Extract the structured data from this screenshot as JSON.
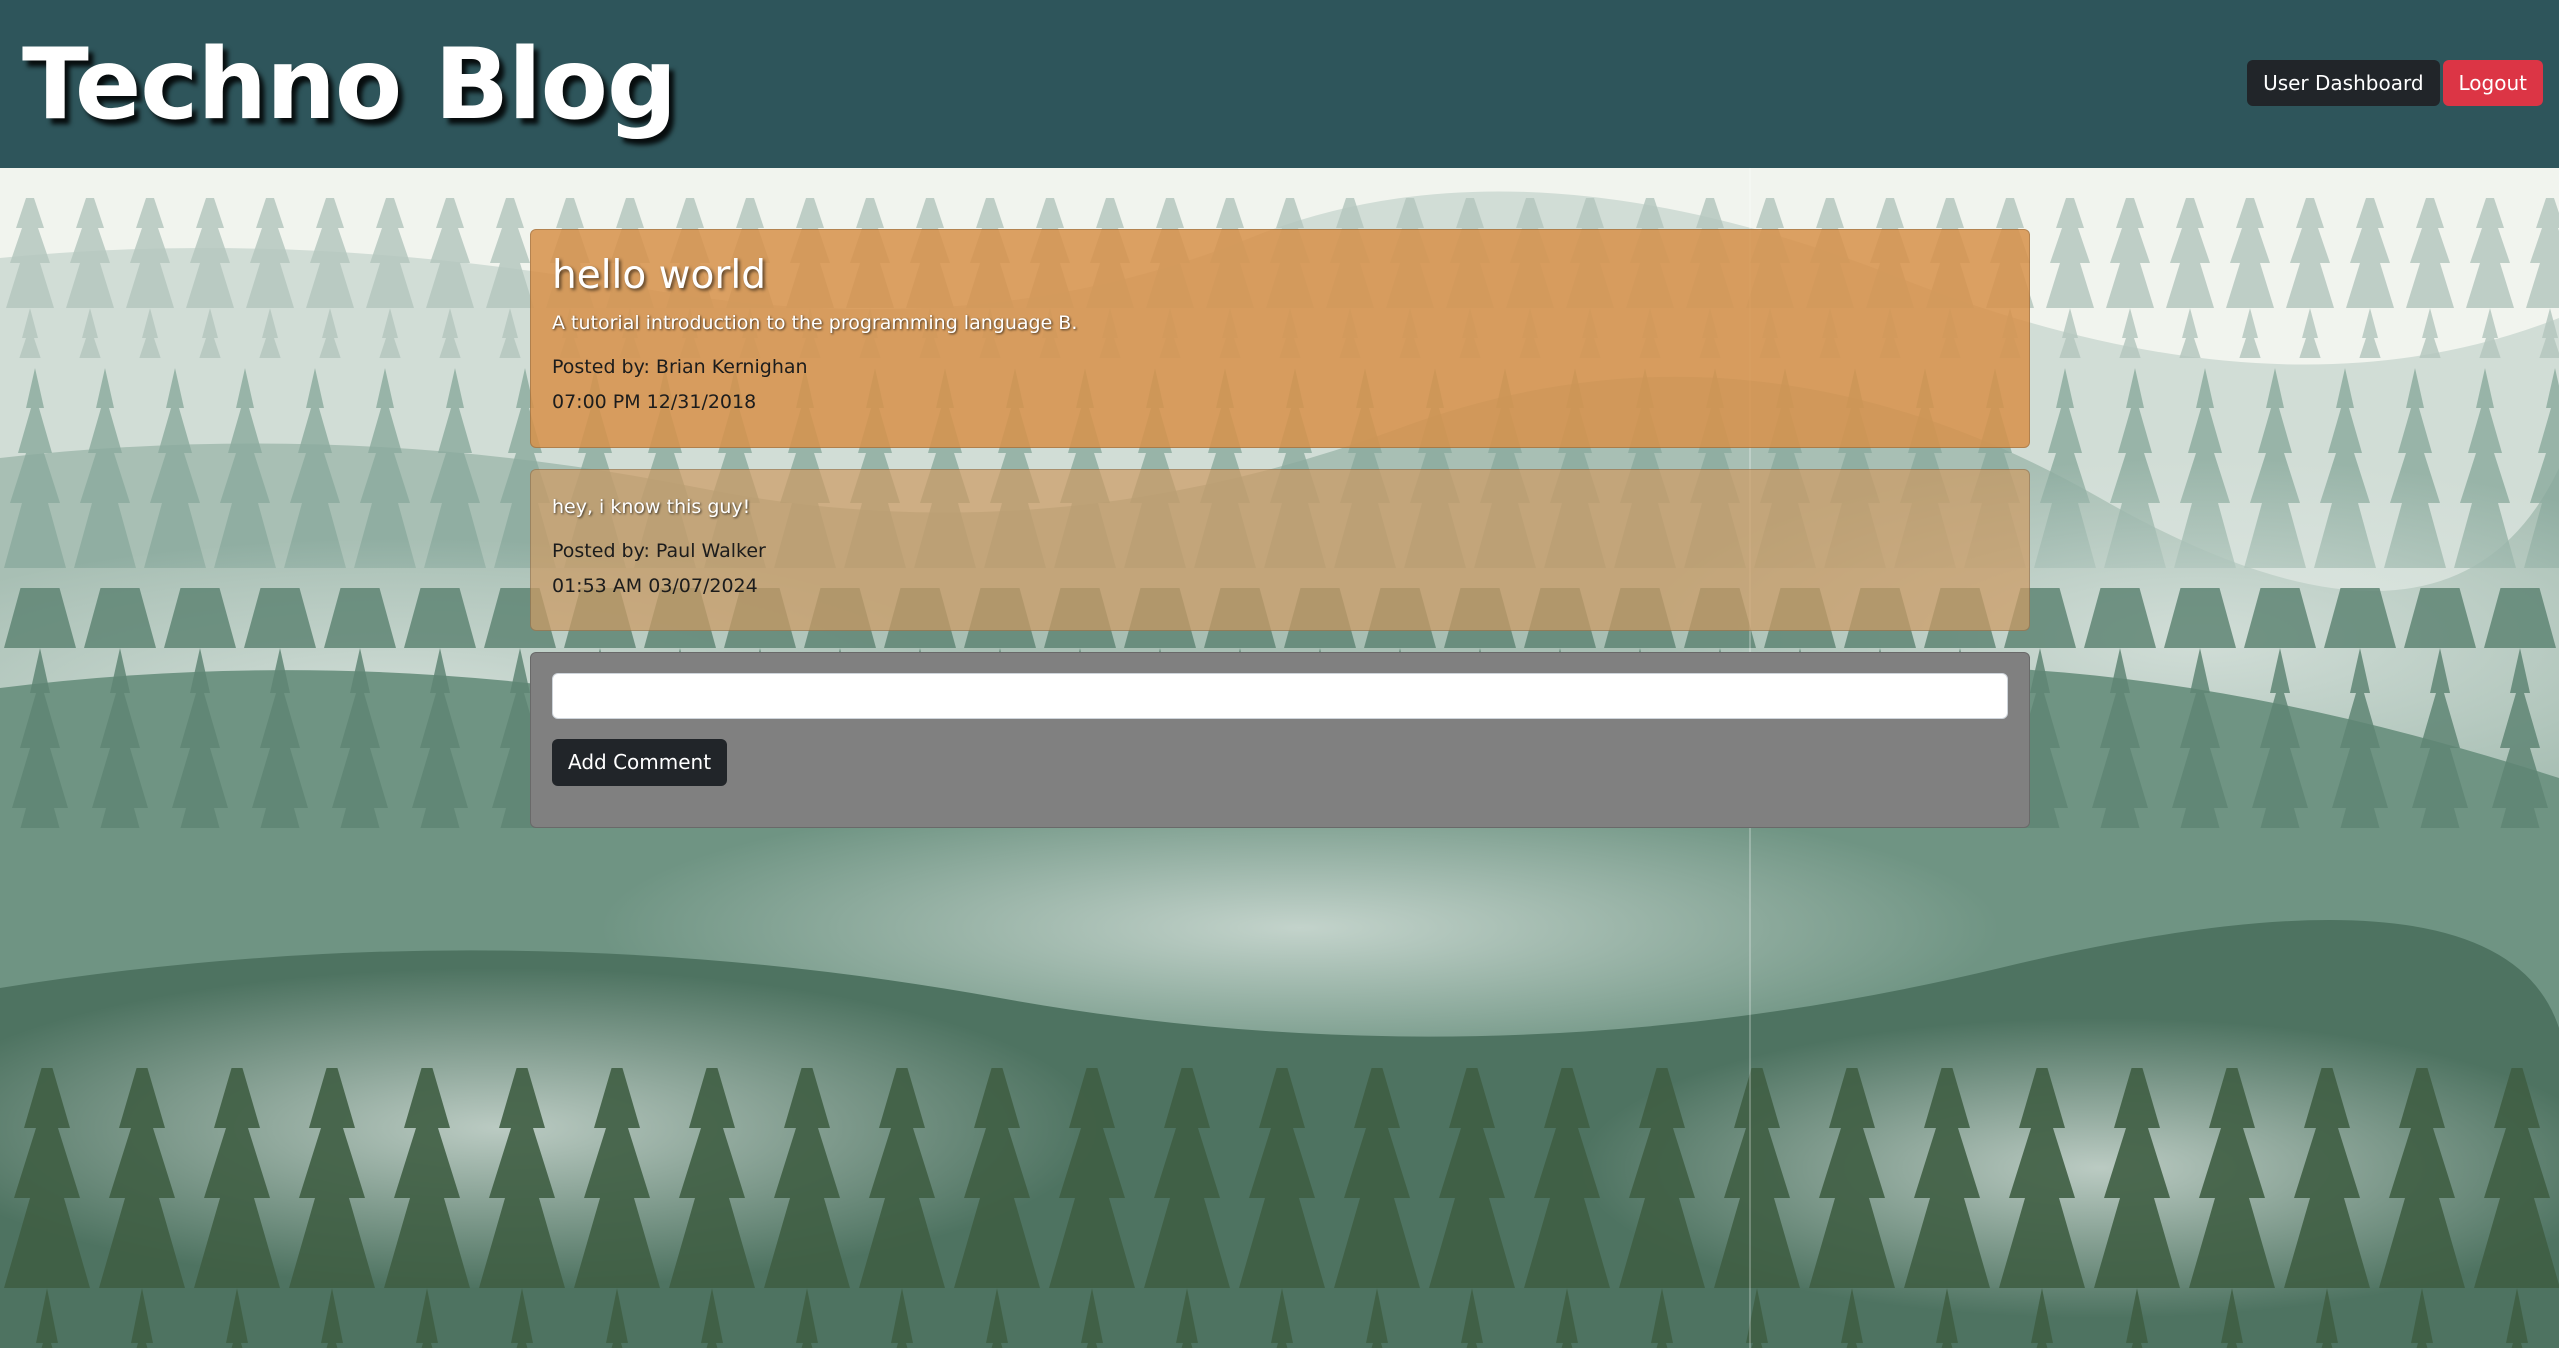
{
  "header": {
    "site_title": "Techno Blog",
    "nav": {
      "dashboard_label": "User Dashboard",
      "logout_label": "Logout"
    }
  },
  "post": {
    "title": "hello world",
    "body": "A tutorial introduction to the programming language B.",
    "posted_by": "Posted by: Brian Kernighan",
    "timestamp": "07:00 PM 12/31/2018"
  },
  "comments": [
    {
      "body": "hey, i know this guy!",
      "posted_by": "Posted by: Paul Walker",
      "timestamp": "01:53 AM 03/07/2024"
    }
  ],
  "comment_form": {
    "input_value": "",
    "submit_label": "Add Comment"
  },
  "colors": {
    "header_bg": "#2e555b",
    "post_card": "#d7914b",
    "comment_card": "#cd9b64",
    "form_card": "#808080",
    "dashboard_button": "#212529",
    "logout_button": "#dc3545",
    "forest": "#4e7361"
  }
}
